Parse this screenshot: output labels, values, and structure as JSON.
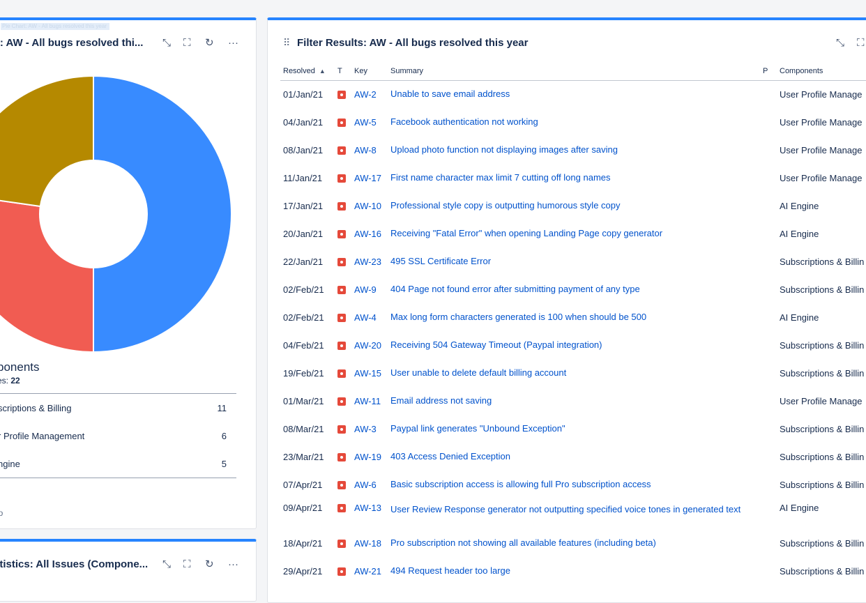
{
  "pie_gadget": {
    "ghost_label": "Pie Chart: AW - All bugs resolved this year",
    "title": "rt: AW - All bugs resolved thi...",
    "icons": [
      "minimize-icon",
      "fullscreen-icon",
      "refresh-icon",
      "more-icon"
    ],
    "icon_glyphs": {
      "minimize": "⤡",
      "fullscreen": "⛶",
      "refresh": "↻",
      "more": "···"
    },
    "legend_title": "ponents",
    "legend_total_label": "es:",
    "legend_total_value": "22",
    "legend": [
      {
        "name": "scriptions & Billing",
        "count": "11",
        "color": "#388bff"
      },
      {
        "name": "r Profile Management",
        "count": "6",
        "color": "#f15c52"
      },
      {
        "name": "ngine",
        "count": "5",
        "color": "#b58900"
      }
    ],
    "footer": "go"
  },
  "chart_data": {
    "type": "pie",
    "title": "",
    "categories": [
      "Subscriptions & Billing",
      "User Profile Management",
      "AI Engine"
    ],
    "values": [
      11,
      6,
      5
    ],
    "colors": [
      "#388bff",
      "#f15c52",
      "#b58900"
    ],
    "donut": true
  },
  "stats_gadget": {
    "title": "atistics: All Issues (Compone..."
  },
  "filter_gadget": {
    "title": "Filter Results: AW - All bugs resolved this year",
    "columns": {
      "resolved": "Resolved",
      "type": "T",
      "key": "Key",
      "summary": "Summary",
      "priority": "P",
      "components": "Components"
    },
    "sort_indicator": "▲",
    "rows": [
      {
        "resolved": "01/Jan/21",
        "key": "AW-2",
        "summary": "Unable to save email address",
        "component": "User Profile Manage"
      },
      {
        "resolved": "04/Jan/21",
        "key": "AW-5",
        "summary": "Facebook authentication not working",
        "component": "User Profile Manage"
      },
      {
        "resolved": "08/Jan/21",
        "key": "AW-8",
        "summary": "Upload photo function not displaying images after saving",
        "component": "User Profile Manage"
      },
      {
        "resolved": "11/Jan/21",
        "key": "AW-17",
        "summary": "First name character max limit 7 cutting off long names",
        "component": "User Profile Manage"
      },
      {
        "resolved": "17/Jan/21",
        "key": "AW-10",
        "summary": "Professional style copy is outputting humorous style copy",
        "component": "AI Engine"
      },
      {
        "resolved": "20/Jan/21",
        "key": "AW-16",
        "summary": "Receiving \"Fatal Error\" when opening Landing Page copy generator",
        "component": "AI Engine"
      },
      {
        "resolved": "22/Jan/21",
        "key": "AW-23",
        "summary": "495 SSL Certificate Error",
        "component": "Subscriptions & Billin"
      },
      {
        "resolved": "02/Feb/21",
        "key": "AW-9",
        "summary": "404 Page not found error after submitting payment of any type",
        "component": "Subscriptions & Billin"
      },
      {
        "resolved": "02/Feb/21",
        "key": "AW-4",
        "summary": "Max long form characters generated is 100 when should be 500",
        "component": "AI Engine"
      },
      {
        "resolved": "04/Feb/21",
        "key": "AW-20",
        "summary": "Receiving 504 Gateway Timeout (Paypal integration)",
        "component": "Subscriptions & Billin"
      },
      {
        "resolved": "19/Feb/21",
        "key": "AW-15",
        "summary": "User unable to delete default billing account",
        "component": "Subscriptions & Billin"
      },
      {
        "resolved": "01/Mar/21",
        "key": "AW-11",
        "summary": "Email address not saving",
        "component": "User Profile Manage"
      },
      {
        "resolved": "08/Mar/21",
        "key": "AW-3",
        "summary": "Paypal link generates \"Unbound Exception\"",
        "component": "Subscriptions & Billin"
      },
      {
        "resolved": "23/Mar/21",
        "key": "AW-19",
        "summary": "403 Access Denied Exception",
        "component": "Subscriptions & Billin"
      },
      {
        "resolved": "07/Apr/21",
        "key": "AW-6",
        "summary": "Basic subscription access is allowing full Pro subscription access",
        "component": "Subscriptions & Billin"
      },
      {
        "resolved": "09/Apr/21",
        "key": "AW-13",
        "summary": "User Review Response generator not outputting specified voice tones in generated text",
        "component": "AI Engine"
      },
      {
        "resolved": "18/Apr/21",
        "key": "AW-18",
        "summary": "Pro subscription not showing all available features (including beta)",
        "component": "Subscriptions & Billin"
      },
      {
        "resolved": "29/Apr/21",
        "key": "AW-21",
        "summary": "494 Request header too large",
        "component": "Subscriptions & Billin"
      }
    ]
  }
}
